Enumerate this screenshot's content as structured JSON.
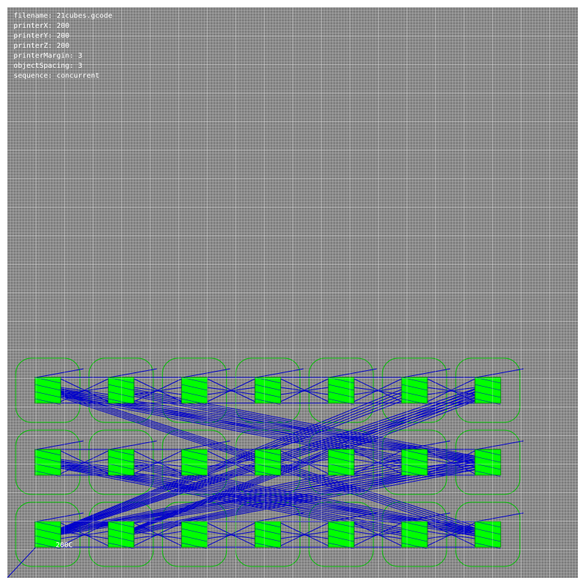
{
  "info": {
    "filename_label": "filename:",
    "filename": "21cubes.gcode",
    "printerX_label": "printerX:",
    "printerX": "200",
    "printerY_label": "printerY:",
    "printerY": "200",
    "printerZ_label": "printerZ:",
    "printerZ": "200",
    "printerMargin_label": "printerMargin:",
    "printerMargin": "3",
    "objectSpacing_label": "objectSpacing:",
    "objectSpacing": "3",
    "sequence_label": "sequence:",
    "sequence": "concurrent"
  },
  "temperature_label": "200C",
  "grid": {
    "columns": 7,
    "rows": 3
  },
  "colors": {
    "background": "#7f7f7f",
    "object": "#00ff00",
    "outline": "#00c000",
    "travel": "#0000cc",
    "text": "#ffffff"
  }
}
